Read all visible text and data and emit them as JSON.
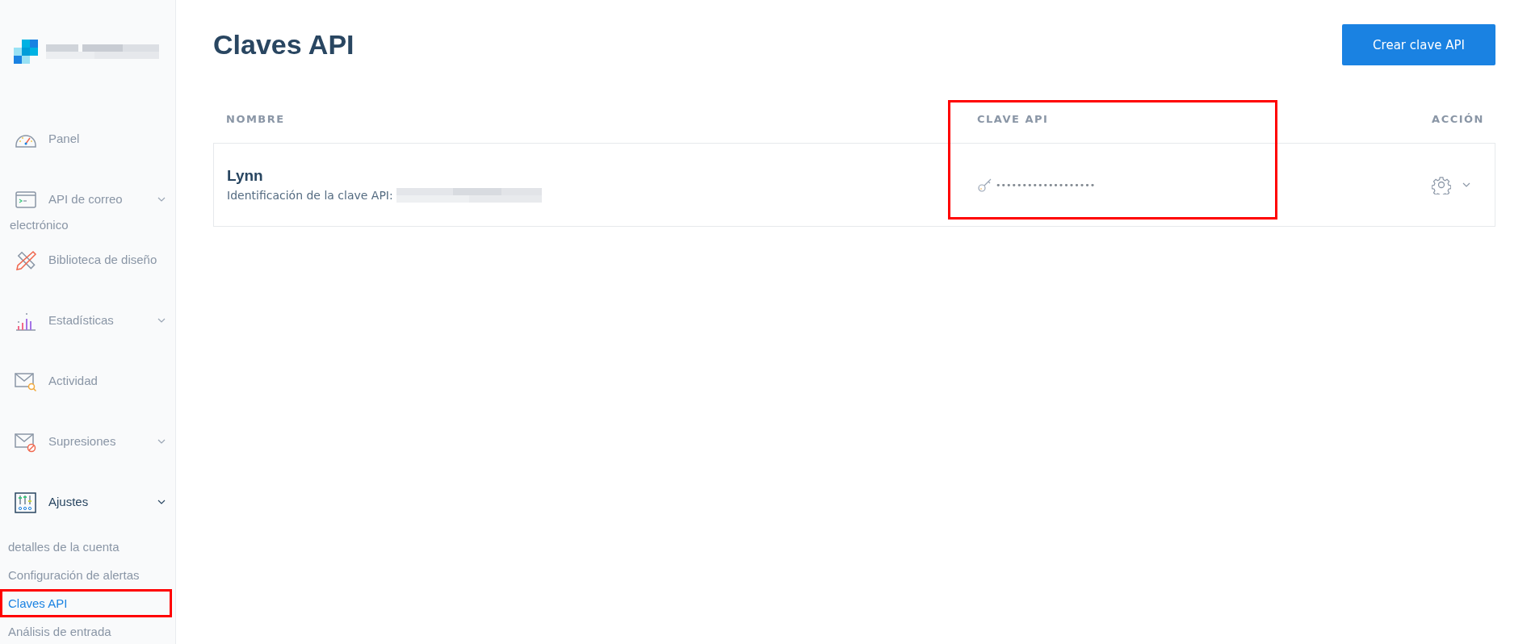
{
  "sidebar": {
    "items": [
      {
        "label": "Panel",
        "kind": "gauge",
        "expandable": false,
        "expanded": false
      },
      {
        "label": "API de correo electrónico",
        "kind": "terminal",
        "expandable": true,
        "expanded": false
      },
      {
        "label": "Biblioteca de diseño",
        "kind": "design",
        "expandable": false,
        "expanded": false
      },
      {
        "label": "Estadísticas",
        "kind": "chart",
        "expandable": true,
        "expanded": false
      },
      {
        "label": "Actividad",
        "kind": "mail-search",
        "expandable": false,
        "expanded": false
      },
      {
        "label": "Supresiones",
        "kind": "mail-block",
        "expandable": true,
        "expanded": false
      },
      {
        "label": "Ajustes",
        "kind": "sliders",
        "expandable": true,
        "expanded": true,
        "children": [
          {
            "label": "detalles de la cuenta",
            "selected": false,
            "highlighted": false
          },
          {
            "label": "Configuración de alertas",
            "selected": false,
            "highlighted": false
          },
          {
            "label": "Claves API",
            "selected": true,
            "highlighted": true
          },
          {
            "label": "Análisis de entrada",
            "selected": false,
            "highlighted": false
          }
        ]
      }
    ]
  },
  "page": {
    "title": "Claves API",
    "create_button": "Crear clave API"
  },
  "table": {
    "columns": [
      {
        "label": "NOMBRE"
      },
      {
        "label": "CLAVE API",
        "highlighted": true
      },
      {
        "label": "ACCIÓN"
      }
    ],
    "rows": [
      {
        "name": "Lynn",
        "id_label": "Identificación de la clave API:",
        "key": "•••••••••••••••••••"
      }
    ]
  }
}
